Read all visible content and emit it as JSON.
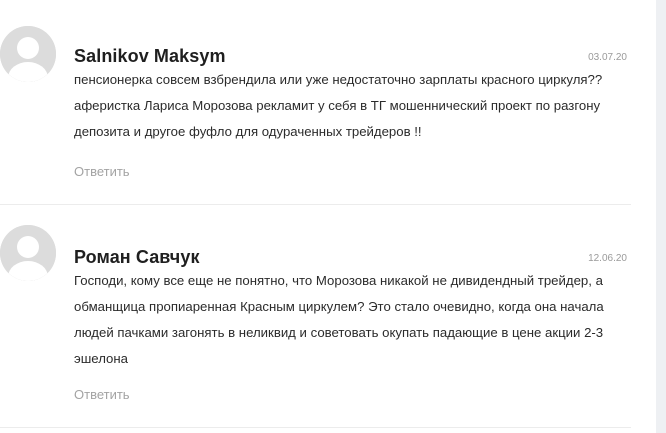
{
  "comments": [
    {
      "author": "Salnikov Maksym",
      "date": "03.07.20",
      "text": "пенсионерка совсем взбрендила или уже недостаточно зарплаты красного циркуля?? аферистка Лариса Морозова рекламит у себя в ТГ мошеннический проект по разгону депозита и другое фуфло для одураченных трейдеров !!",
      "reply_label": "Ответить"
    },
    {
      "author": "Роман Савчук",
      "date": "12.06.20",
      "text": "Господи, кому все еще не понятно, что Морозова никакой не дивидендный трейдер, а обманщица пропиаренная Красным циркулем? Это стало очевидно, когда она начала людей пачками загонять в неликвид и советовать окупать падающие в цене акции 2-3 эшелона",
      "reply_label": "Ответить"
    }
  ],
  "icons": {
    "avatar": "user-avatar-placeholder-icon"
  },
  "colors": {
    "avatar_bg": "#dcdcdc",
    "avatar_fg": "#ffffff",
    "author": "#1f1f1f",
    "text": "#2b2b2b",
    "muted": "#a3a3a3"
  }
}
